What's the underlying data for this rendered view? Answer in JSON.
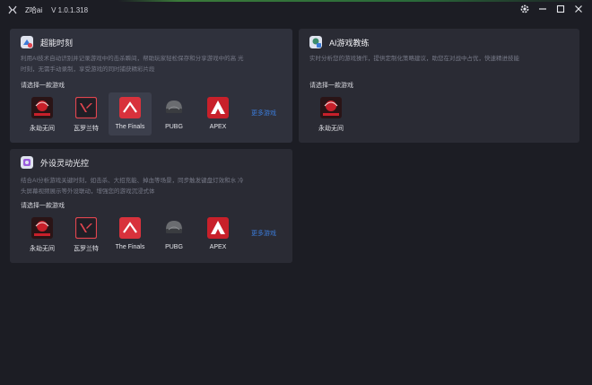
{
  "app": {
    "name": "Z哈ai",
    "version": "V 1.0.1.318"
  },
  "cards": {
    "highlight": {
      "title": "超能时刻",
      "desc1": "利用AI技术自动识别并记录游戏中的击杀瞬间，帮助玩家轻松保存和分享游戏中的高 光",
      "desc2": "时刻，无需手动录制，享受游戏的同时捕获精彩片段",
      "select_label": "请选择一款游戏",
      "more": "更多游戏",
      "games": [
        "永劫无间",
        "瓦罗兰特",
        "The Finals",
        "PUBG",
        "APEX"
      ]
    },
    "coach": {
      "title": "AI游戏教练",
      "desc": "实时分析您的游戏操作，提供定制化策略建议，助您在对战中占优，快速精进技能",
      "select_label": "请选择一款游戏",
      "games": [
        "永劫无间"
      ]
    },
    "lighting": {
      "title": "外设灵动光控",
      "desc1": "结合AI分析游戏关键时刻，如击杀、大招充能、掉血等场景，同步触发键盘灯效和水 冷",
      "desc2": "头屏幕视频展示等外设联动，增强您的游戏沉浸式体",
      "select_label": "请选择一款游戏",
      "more": "更多游戏",
      "games": [
        "永劫无间",
        "瓦罗兰特",
        "The Finals",
        "PUBG",
        "APEX"
      ]
    }
  },
  "colors": {
    "accent_blue": "#3b7bd8",
    "valorant_red": "#e0454f",
    "finals_red": "#d8323c",
    "apex_red": "#c8202a"
  },
  "icons": {
    "game_icons": [
      "naraka-icon",
      "valorant-icon",
      "the-finals-icon",
      "pubg-icon",
      "apex-icon"
    ]
  }
}
